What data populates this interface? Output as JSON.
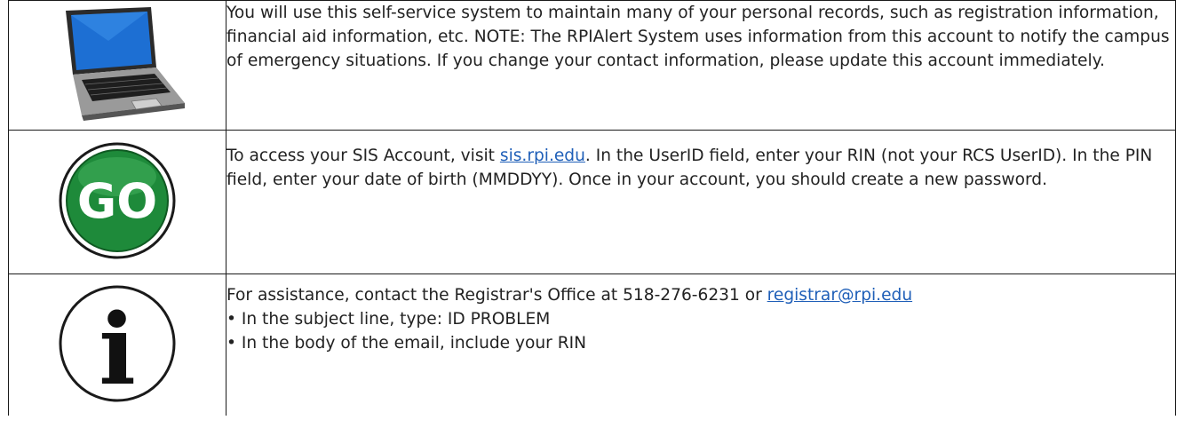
{
  "rows": [
    {
      "icon": "laptop-icon",
      "text": "You will use this self-service system to maintain many of your personal records, such as registration information, financial aid information, etc. NOTE: The RPIAlert System uses information from this account to notify the campus of emergency situations. If you change your contact information, please update this account immediately."
    },
    {
      "icon": "go-button-icon",
      "icon_text": "GO",
      "text_before_link": "To access your SIS Account, visit ",
      "link_text": "sis.rpi.edu",
      "text_after_link": ". In the UserID field, enter your RIN (not your RCS UserID).  In the PIN field, enter your date of birth (MMDDYY). Once in your account, you should create a new password."
    },
    {
      "icon": "info-icon",
      "icon_text": "i",
      "text_before_link": "For assistance, contact the Registrar's Office at 518-276-6231 or ",
      "link_text": "registrar@rpi.edu",
      "bullets": [
        "• In the subject line, type: ID PROBLEM",
        "• In the body of the email, include your RIN"
      ]
    }
  ],
  "colors": {
    "link": "#1f5fb8",
    "go_green": "#1e8a3a",
    "border": "#1a1a1a"
  }
}
